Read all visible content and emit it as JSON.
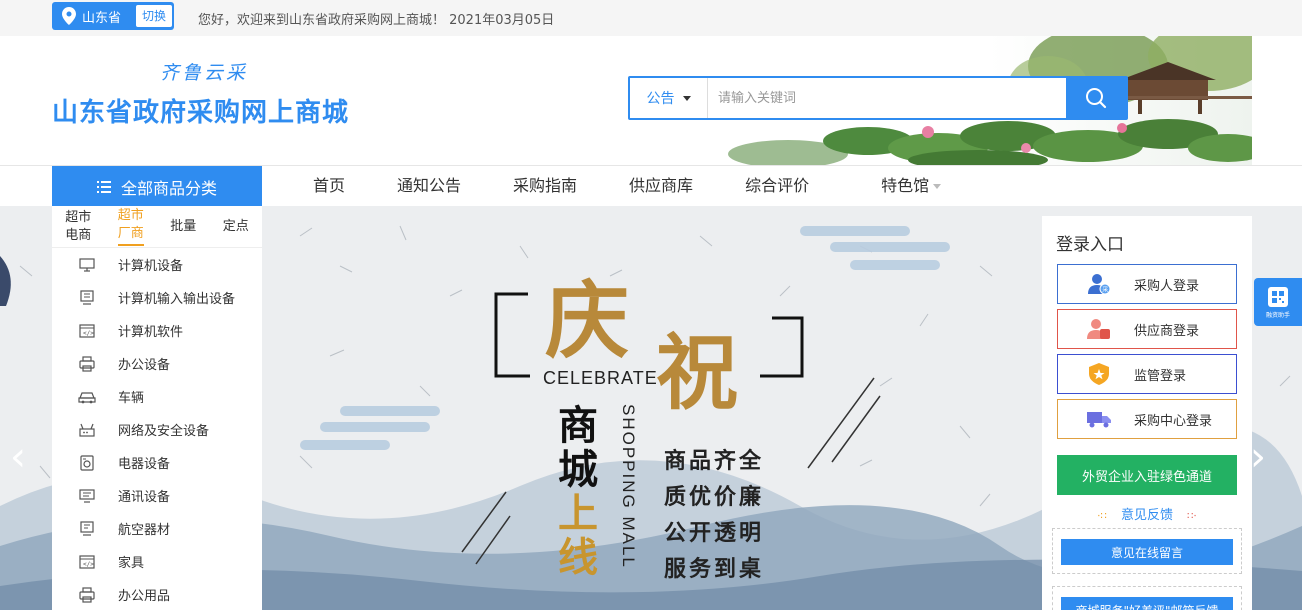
{
  "topbar": {
    "province": "山东省",
    "switch_label": "切换",
    "welcome": "您好，欢迎来到山东省政府采购网上商城！ 2021年03月05日"
  },
  "header": {
    "logo_subtitle": "齐鲁云采",
    "logo_title": "山东省政府采购网上商城"
  },
  "search": {
    "type_label": "公告",
    "placeholder": "请输入关键词"
  },
  "nav": {
    "all_categories": "全部商品分类",
    "items": [
      "首页",
      "通知公告",
      "采购指南",
      "供应商库",
      "综合评价",
      "特色馆"
    ]
  },
  "category_tabs": [
    {
      "line1": "超市",
      "line2": "电商"
    },
    {
      "line1": "超市",
      "line2": "厂商"
    },
    {
      "line1": "批量",
      "line2": ""
    },
    {
      "line1": "定点",
      "line2": ""
    }
  ],
  "categories": [
    {
      "label": "计算机设备",
      "icon": "monitor-icon"
    },
    {
      "label": "计算机输入输出设备",
      "icon": "io-device-icon"
    },
    {
      "label": "计算机软件",
      "icon": "software-icon"
    },
    {
      "label": "办公设备",
      "icon": "printer-icon"
    },
    {
      "label": "车辆",
      "icon": "car-icon"
    },
    {
      "label": "网络及安全设备",
      "icon": "router-icon"
    },
    {
      "label": "电器设备",
      "icon": "appliance-icon"
    },
    {
      "label": "通讯设备",
      "icon": "phone-device-icon"
    },
    {
      "label": "航空器材",
      "icon": "aviation-icon"
    },
    {
      "label": "家具",
      "icon": "furniture-icon"
    },
    {
      "label": "办公用品",
      "icon": "office-supplies-icon"
    }
  ],
  "banner": {
    "char1": "庆",
    "char2": "祝",
    "celebrate": "CELEBRATE",
    "mall_chars": [
      "商",
      "城",
      "上",
      "线"
    ],
    "shopping_mall": "SHOPPING MALL",
    "slogans": [
      "商品齐全",
      "质优价廉",
      "公开透明",
      "服务到桌"
    ]
  },
  "login": {
    "title": "登录入口",
    "buttons": [
      {
        "label": "采购人登录",
        "border": "#3b6fd1",
        "icon": "purchaser-icon"
      },
      {
        "label": "供应商登录",
        "border": "#e0554a",
        "icon": "supplier-icon"
      },
      {
        "label": "监管登录",
        "border": "#3b4fd1",
        "icon": "shield-star-icon"
      },
      {
        "label": "采购中心登录",
        "border": "#e0a040",
        "icon": "truck-icon"
      }
    ],
    "green_channel": "外贸企业入驻绿色通道",
    "feedback_title": "意见反馈",
    "online_message": "意见在线留言",
    "service_text": "商城服务\"好差评\"邮箱反馈"
  },
  "assistant": {
    "label": "融资助手"
  },
  "colors": {
    "primary": "#2f8cf0",
    "active_tab": "#f0a020",
    "green": "#23b163",
    "gold": "#b8893a"
  }
}
